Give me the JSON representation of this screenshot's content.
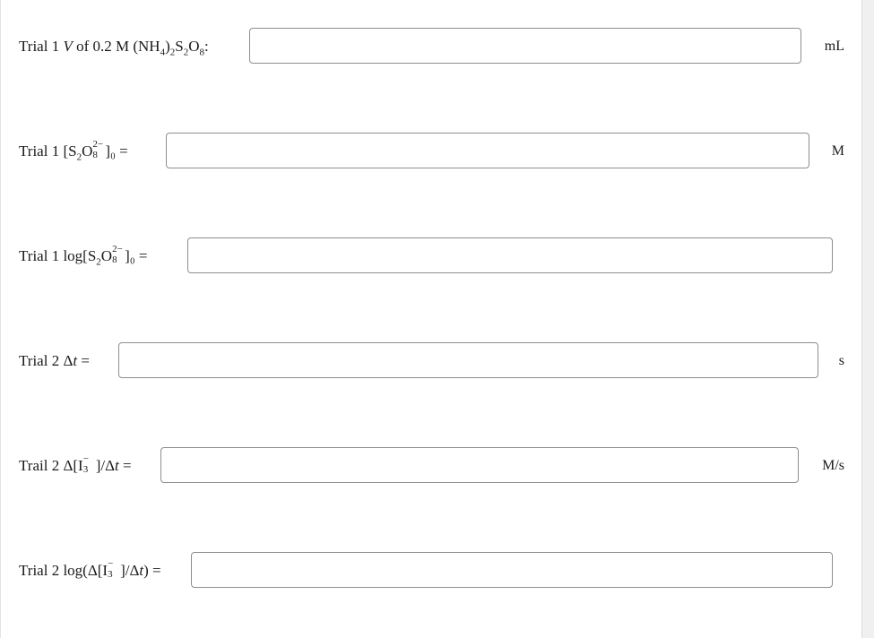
{
  "rows": [
    {
      "label_prefix": "Trial 1 ",
      "label_var": "V",
      "label_mid": " of 0.2 M (NH",
      "sub1": "4",
      "mid2": ")",
      "sub2": "2",
      "mid3": "S",
      "sub3": "2",
      "mid4": "O",
      "sub4": "8",
      "label_suffix": ":",
      "value": "",
      "unit": "mL"
    },
    {
      "label_prefix": "Trial 1 [S",
      "sub1": "2",
      "mid1": "O",
      "sup2": "2−",
      "sub2": "8",
      "label_suffix": "]₀ =",
      "value": "",
      "unit": "M"
    },
    {
      "label_prefix": "Trial 1 log[S",
      "sub1": "2",
      "mid1": "O",
      "sup2": "2−",
      "sub2": "8",
      "label_suffix": "]₀ =",
      "value": "",
      "unit": ""
    },
    {
      "label_prefix": "Trial 2 Δ",
      "label_var": "t",
      "label_suffix": " =",
      "value": "",
      "unit": "s"
    },
    {
      "label_prefix": "Trail 2 Δ[I",
      "sup1": "−",
      "sub1": "3",
      "label_mid": "]/Δ",
      "label_var": "t",
      "label_suffix": " =",
      "value": "",
      "unit": "M/s"
    },
    {
      "label_prefix": "Trial 2 log(Δ[I",
      "sup1": "−",
      "sub1": "3",
      "label_mid": "]/Δ",
      "label_var": "t",
      "label_suffix": ") =",
      "value": "",
      "unit": ""
    }
  ]
}
